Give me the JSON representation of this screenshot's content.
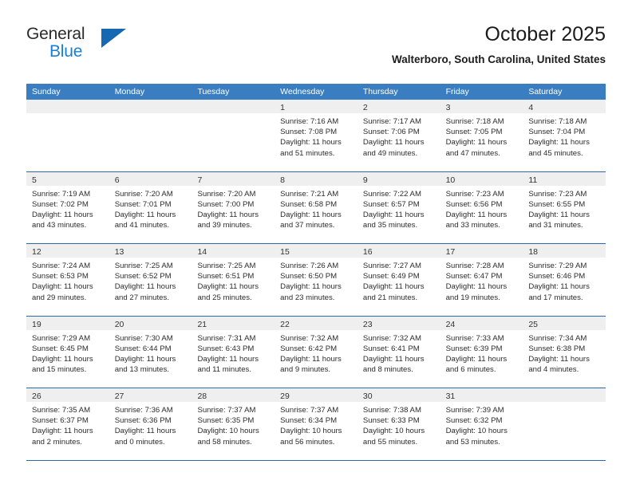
{
  "brand": {
    "name_part1": "General",
    "name_part2": "Blue",
    "logo_icon": "triangle-logo-icon"
  },
  "header": {
    "title": "October 2025",
    "location": "Walterboro, South Carolina, United States"
  },
  "calendar": {
    "weekday_headers": [
      "Sunday",
      "Monday",
      "Tuesday",
      "Wednesday",
      "Thursday",
      "Friday",
      "Saturday"
    ],
    "accent_color": "#3a7ec1",
    "border_color": "#2a6aa8",
    "datebar_color": "#efefef",
    "weeks": [
      [
        {
          "date": "",
          "lines": []
        },
        {
          "date": "",
          "lines": []
        },
        {
          "date": "",
          "lines": []
        },
        {
          "date": "1",
          "lines": [
            "Sunrise: 7:16 AM",
            "Sunset: 7:08 PM",
            "Daylight: 11 hours",
            "and 51 minutes."
          ]
        },
        {
          "date": "2",
          "lines": [
            "Sunrise: 7:17 AM",
            "Sunset: 7:06 PM",
            "Daylight: 11 hours",
            "and 49 minutes."
          ]
        },
        {
          "date": "3",
          "lines": [
            "Sunrise: 7:18 AM",
            "Sunset: 7:05 PM",
            "Daylight: 11 hours",
            "and 47 minutes."
          ]
        },
        {
          "date": "4",
          "lines": [
            "Sunrise: 7:18 AM",
            "Sunset: 7:04 PM",
            "Daylight: 11 hours",
            "and 45 minutes."
          ]
        }
      ],
      [
        {
          "date": "5",
          "lines": [
            "Sunrise: 7:19 AM",
            "Sunset: 7:02 PM",
            "Daylight: 11 hours",
            "and 43 minutes."
          ]
        },
        {
          "date": "6",
          "lines": [
            "Sunrise: 7:20 AM",
            "Sunset: 7:01 PM",
            "Daylight: 11 hours",
            "and 41 minutes."
          ]
        },
        {
          "date": "7",
          "lines": [
            "Sunrise: 7:20 AM",
            "Sunset: 7:00 PM",
            "Daylight: 11 hours",
            "and 39 minutes."
          ]
        },
        {
          "date": "8",
          "lines": [
            "Sunrise: 7:21 AM",
            "Sunset: 6:58 PM",
            "Daylight: 11 hours",
            "and 37 minutes."
          ]
        },
        {
          "date": "9",
          "lines": [
            "Sunrise: 7:22 AM",
            "Sunset: 6:57 PM",
            "Daylight: 11 hours",
            "and 35 minutes."
          ]
        },
        {
          "date": "10",
          "lines": [
            "Sunrise: 7:23 AM",
            "Sunset: 6:56 PM",
            "Daylight: 11 hours",
            "and 33 minutes."
          ]
        },
        {
          "date": "11",
          "lines": [
            "Sunrise: 7:23 AM",
            "Sunset: 6:55 PM",
            "Daylight: 11 hours",
            "and 31 minutes."
          ]
        }
      ],
      [
        {
          "date": "12",
          "lines": [
            "Sunrise: 7:24 AM",
            "Sunset: 6:53 PM",
            "Daylight: 11 hours",
            "and 29 minutes."
          ]
        },
        {
          "date": "13",
          "lines": [
            "Sunrise: 7:25 AM",
            "Sunset: 6:52 PM",
            "Daylight: 11 hours",
            "and 27 minutes."
          ]
        },
        {
          "date": "14",
          "lines": [
            "Sunrise: 7:25 AM",
            "Sunset: 6:51 PM",
            "Daylight: 11 hours",
            "and 25 minutes."
          ]
        },
        {
          "date": "15",
          "lines": [
            "Sunrise: 7:26 AM",
            "Sunset: 6:50 PM",
            "Daylight: 11 hours",
            "and 23 minutes."
          ]
        },
        {
          "date": "16",
          "lines": [
            "Sunrise: 7:27 AM",
            "Sunset: 6:49 PM",
            "Daylight: 11 hours",
            "and 21 minutes."
          ]
        },
        {
          "date": "17",
          "lines": [
            "Sunrise: 7:28 AM",
            "Sunset: 6:47 PM",
            "Daylight: 11 hours",
            "and 19 minutes."
          ]
        },
        {
          "date": "18",
          "lines": [
            "Sunrise: 7:29 AM",
            "Sunset: 6:46 PM",
            "Daylight: 11 hours",
            "and 17 minutes."
          ]
        }
      ],
      [
        {
          "date": "19",
          "lines": [
            "Sunrise: 7:29 AM",
            "Sunset: 6:45 PM",
            "Daylight: 11 hours",
            "and 15 minutes."
          ]
        },
        {
          "date": "20",
          "lines": [
            "Sunrise: 7:30 AM",
            "Sunset: 6:44 PM",
            "Daylight: 11 hours",
            "and 13 minutes."
          ]
        },
        {
          "date": "21",
          "lines": [
            "Sunrise: 7:31 AM",
            "Sunset: 6:43 PM",
            "Daylight: 11 hours",
            "and 11 minutes."
          ]
        },
        {
          "date": "22",
          "lines": [
            "Sunrise: 7:32 AM",
            "Sunset: 6:42 PM",
            "Daylight: 11 hours",
            "and 9 minutes."
          ]
        },
        {
          "date": "23",
          "lines": [
            "Sunrise: 7:32 AM",
            "Sunset: 6:41 PM",
            "Daylight: 11 hours",
            "and 8 minutes."
          ]
        },
        {
          "date": "24",
          "lines": [
            "Sunrise: 7:33 AM",
            "Sunset: 6:39 PM",
            "Daylight: 11 hours",
            "and 6 minutes."
          ]
        },
        {
          "date": "25",
          "lines": [
            "Sunrise: 7:34 AM",
            "Sunset: 6:38 PM",
            "Daylight: 11 hours",
            "and 4 minutes."
          ]
        }
      ],
      [
        {
          "date": "26",
          "lines": [
            "Sunrise: 7:35 AM",
            "Sunset: 6:37 PM",
            "Daylight: 11 hours",
            "and 2 minutes."
          ]
        },
        {
          "date": "27",
          "lines": [
            "Sunrise: 7:36 AM",
            "Sunset: 6:36 PM",
            "Daylight: 11 hours",
            "and 0 minutes."
          ]
        },
        {
          "date": "28",
          "lines": [
            "Sunrise: 7:37 AM",
            "Sunset: 6:35 PM",
            "Daylight: 10 hours",
            "and 58 minutes."
          ]
        },
        {
          "date": "29",
          "lines": [
            "Sunrise: 7:37 AM",
            "Sunset: 6:34 PM",
            "Daylight: 10 hours",
            "and 56 minutes."
          ]
        },
        {
          "date": "30",
          "lines": [
            "Sunrise: 7:38 AM",
            "Sunset: 6:33 PM",
            "Daylight: 10 hours",
            "and 55 minutes."
          ]
        },
        {
          "date": "31",
          "lines": [
            "Sunrise: 7:39 AM",
            "Sunset: 6:32 PM",
            "Daylight: 10 hours",
            "and 53 minutes."
          ]
        },
        {
          "date": "",
          "lines": []
        }
      ]
    ]
  }
}
